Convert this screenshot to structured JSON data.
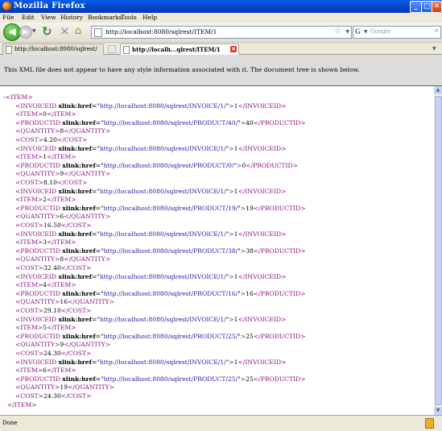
{
  "window": {
    "title": "Mozilla Firefox",
    "buttons": {
      "minimize": "_",
      "maximize": "□",
      "close": "✕"
    }
  },
  "menu": [
    "File",
    "Edit",
    "View",
    "History",
    "Bookmarks",
    "Tools",
    "Help"
  ],
  "nav": {
    "back_glyph": "◀",
    "forward_glyph": "▶",
    "reload_glyph": "↻",
    "stop_glyph": "✕",
    "home_glyph": "⌂",
    "url": "http://localhost:8080/sqlrest/ITEM/1",
    "search_placeholder": "Google"
  },
  "tabs": [
    {
      "label": "http://localhost:8080/sqlrest/",
      "active": false
    },
    {
      "label": "http://localh...qlrest/ITEM/1",
      "active": true
    }
  ],
  "info_message": "This XML file does not appear to have any style information associated with it. The document tree is shown below.",
  "xml": {
    "root_open": "-<ITEM>",
    "root_close": "</ITEM>",
    "attr_name": "xlink:href",
    "records": [
      {
        "invoice_href": "http://localhost:8080/sqlrest/INVOICE/1/",
        "invoice": "1",
        "item": "0",
        "product_href": "http://localhost:8080/sqlrest/PRODUCT/40/",
        "product": "40",
        "quantity": "8",
        "cost": "4.20"
      },
      {
        "invoice_href": "http://localhost:8080/sqlrest/INVOICE/1/",
        "invoice": "1",
        "item": "1",
        "product_href": "http://localhost:8080/sqlrest/PRODUCT/0/",
        "product": "0",
        "quantity": "9",
        "cost": "8.10"
      },
      {
        "invoice_href": "http://localhost:8080/sqlrest/INVOICE/1/",
        "invoice": "1",
        "item": "2",
        "product_href": "http://localhost:8080/sqlrest/PRODUCT/19/",
        "product": "19",
        "quantity": "6",
        "cost": "16.50"
      },
      {
        "invoice_href": "http://localhost:8080/sqlrest/INVOICE/1/",
        "invoice": "1",
        "item": "3",
        "product_href": "http://localhost:8080/sqlrest/PRODUCT/38/",
        "product": "38",
        "quantity": "8",
        "cost": "32.40"
      },
      {
        "invoice_href": "http://localhost:8080/sqlrest/INVOICE/1/",
        "invoice": "1",
        "item": "4",
        "product_href": "http://localhost:8080/sqlrest/PRODUCT/16/",
        "product": "16",
        "quantity": "16",
        "cost": "29.10"
      },
      {
        "invoice_href": "http://localhost:8080/sqlrest/INVOICE/1/",
        "invoice": "1",
        "item": "5",
        "product_href": "http://localhost:8080/sqlrest/PRODUCT/25/",
        "product": "25",
        "quantity": "9",
        "cost": "24.30"
      },
      {
        "invoice_href": "http://localhost:8080/sqlrest/INVOICE/1/",
        "invoice": "1",
        "item": "6",
        "product_href": "http://localhost:8080/sqlrest/PRODUCT/25/",
        "product": "25",
        "quantity": "19",
        "cost": "24.30"
      }
    ]
  },
  "status": "Done",
  "icons": {
    "app": "firefox-icon",
    "page": "page-icon",
    "bookmark": "star-icon",
    "search": "magnifier-icon"
  }
}
